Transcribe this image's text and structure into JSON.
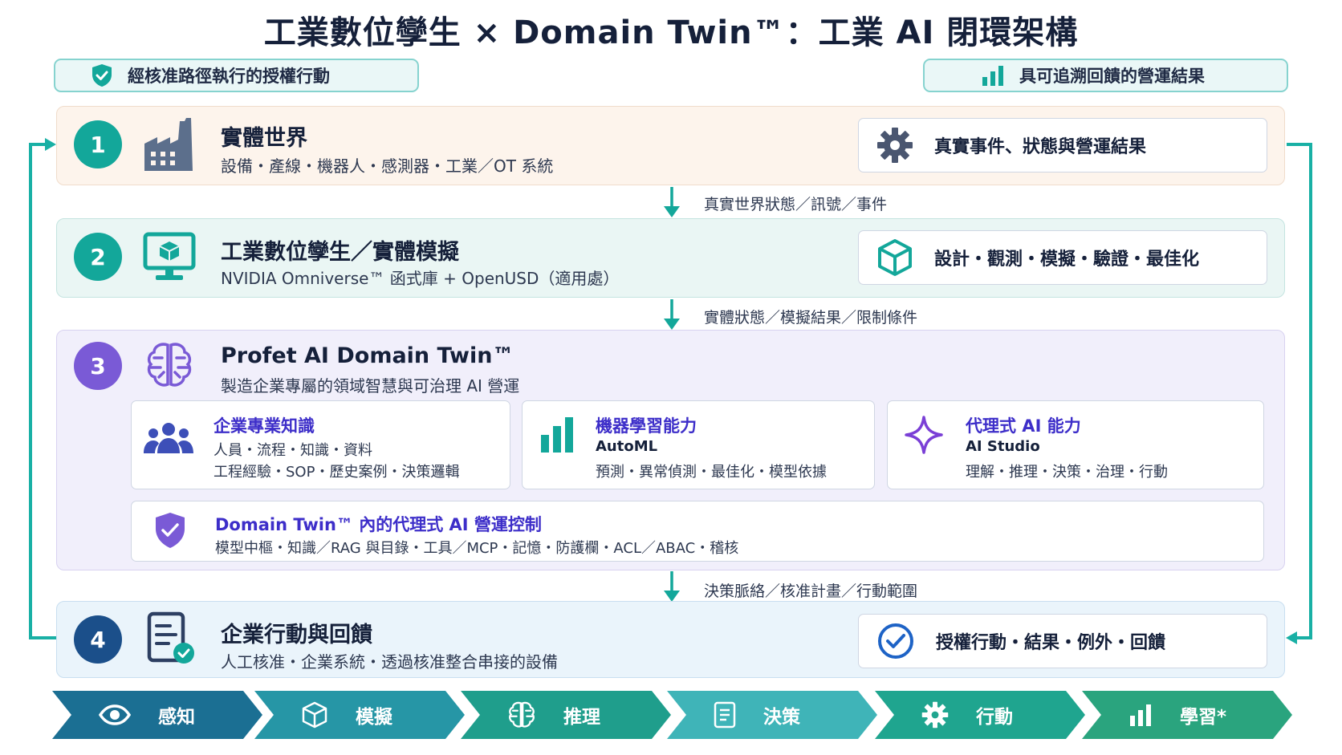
{
  "title": "工業數位孿生 × Domain Twin™：工業 AI 閉環架構",
  "badges": {
    "left": {
      "icon": "shield-check-icon",
      "label": "經核准路徑執行的授權行動"
    },
    "right": {
      "icon": "bar-chart-icon",
      "label": "具可追溯回饋的營運結果"
    }
  },
  "layers": [
    {
      "number": "1",
      "icon": "factory-icon",
      "title": "實體世界",
      "subtitle": "設備・產線・機器人・感測器・工業／OT 系統",
      "output_icon": "gear-icon",
      "output": "真實事件、狀態與營運結果"
    },
    {
      "number": "2",
      "icon": "monitor-cube-icon",
      "title": "工業數位孿生／實體模擬",
      "subtitle": "NVIDIA Omniverse™ 函式庫 + OpenUSD（適用處）",
      "output_icon": "cube-icon",
      "output": "設計・觀測・模擬・驗證・最佳化"
    },
    {
      "number": "3",
      "icon": "brain-icon",
      "title": "Profet AI Domain Twin™",
      "subtitle": "製造企業專屬的領域智慧與可治理 AI 營運"
    },
    {
      "number": "4",
      "icon": "checklist-icon",
      "title": "企業行動與回饋",
      "subtitle": "人工核准・企業系統・透過核准整合串接的設備",
      "output_icon": "check-circle-icon",
      "output": "授權行動・結果・例外・回饋"
    }
  ],
  "flows": [
    "真實世界狀態／訊號／事件",
    "實體狀態／模擬結果／限制條件",
    "決策脈絡／核准計畫／行動範圍"
  ],
  "domain_cards": [
    {
      "icon": "people-icon",
      "title": "企業專業知識",
      "line1": "人員・流程・知識・資料",
      "line2": "工程經驗・SOP・歷史案例・決策邏輯"
    },
    {
      "icon": "bar-chart-icon",
      "title": "機器學習能力",
      "line1": "AutoML",
      "line2": "預測・異常偵測・最佳化・模型依據"
    },
    {
      "icon": "sparkle-icon",
      "title": "代理式 AI 能力",
      "line1": "AI Studio",
      "line2": "理解・推理・決策・治理・行動"
    }
  ],
  "control_card": {
    "icon": "shield-check-icon",
    "title": "Domain Twin™ 內的代理式 AI 營運控制",
    "line": "模型中樞・知識／RAG 與目錄・工具／MCP・記憶・防護欄・ACL／ABAC・稽核"
  },
  "stages": [
    {
      "icon": "eye-icon",
      "label": "感知",
      "color": "#1b6f93"
    },
    {
      "icon": "cube-icon",
      "label": "模擬",
      "color": "#2696a6"
    },
    {
      "icon": "brain-icon",
      "label": "推理",
      "color": "#1f9e8c"
    },
    {
      "icon": "document-icon",
      "label": "決策",
      "color": "#3fb4b8"
    },
    {
      "icon": "gear-icon",
      "label": "行動",
      "color": "#1fa58f"
    },
    {
      "icon": "bar-chart-icon",
      "label": "學習*",
      "color": "#2aa47e"
    }
  ],
  "colors": {
    "teal": "#13a79a",
    "purple": "#7a5ad6",
    "navy": "#1b4f8a",
    "loop": "#19b0a5"
  }
}
